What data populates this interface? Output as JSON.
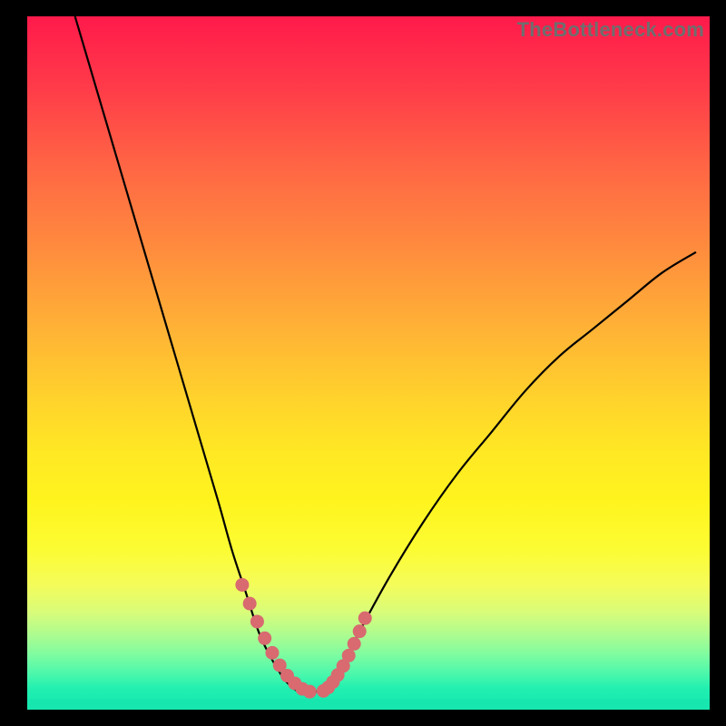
{
  "attribution": "TheBottleneck.com",
  "colors": {
    "bg": "#000000",
    "gradient_top": "#ff1a4b",
    "gradient_bottom": "#16e8af",
    "curve": "#000000",
    "marker": "#d86a70",
    "attribution_text": "#6e6e6e"
  },
  "chart_data": {
    "type": "line",
    "title": "",
    "xlabel": "",
    "ylabel": "",
    "xlim": [
      0,
      100
    ],
    "ylim": [
      0,
      100
    ],
    "x": [
      7,
      10,
      13,
      16,
      19,
      22,
      25,
      28,
      30,
      32,
      34,
      36,
      38,
      40,
      42,
      44,
      46,
      48,
      53,
      58,
      63,
      68,
      73,
      78,
      83,
      88,
      93,
      98
    ],
    "y": [
      100,
      90,
      80,
      70,
      60,
      50,
      40,
      30,
      23,
      17,
      11,
      7,
      4,
      2.5,
      2.5,
      3.5,
      6,
      10,
      19,
      27,
      34,
      40,
      46,
      51,
      55,
      59,
      63,
      66
    ],
    "series_name": "bottleneck-curve",
    "highlight_points": {
      "comment": "pink dotted segment near the trough",
      "x": [
        31.5,
        32.6,
        33.7,
        34.8,
        35.9,
        37.0,
        38.1,
        39.2,
        40.3,
        41.4,
        43.4,
        44.1,
        44.8,
        45.5,
        46.3,
        47.1,
        47.9,
        48.7,
        49.5
      ],
      "y": [
        18.0,
        15.3,
        12.7,
        10.3,
        8.2,
        6.4,
        4.9,
        3.8,
        3.0,
        2.6,
        2.7,
        3.2,
        4.0,
        5.0,
        6.3,
        7.8,
        9.5,
        11.3,
        13.2
      ]
    }
  }
}
